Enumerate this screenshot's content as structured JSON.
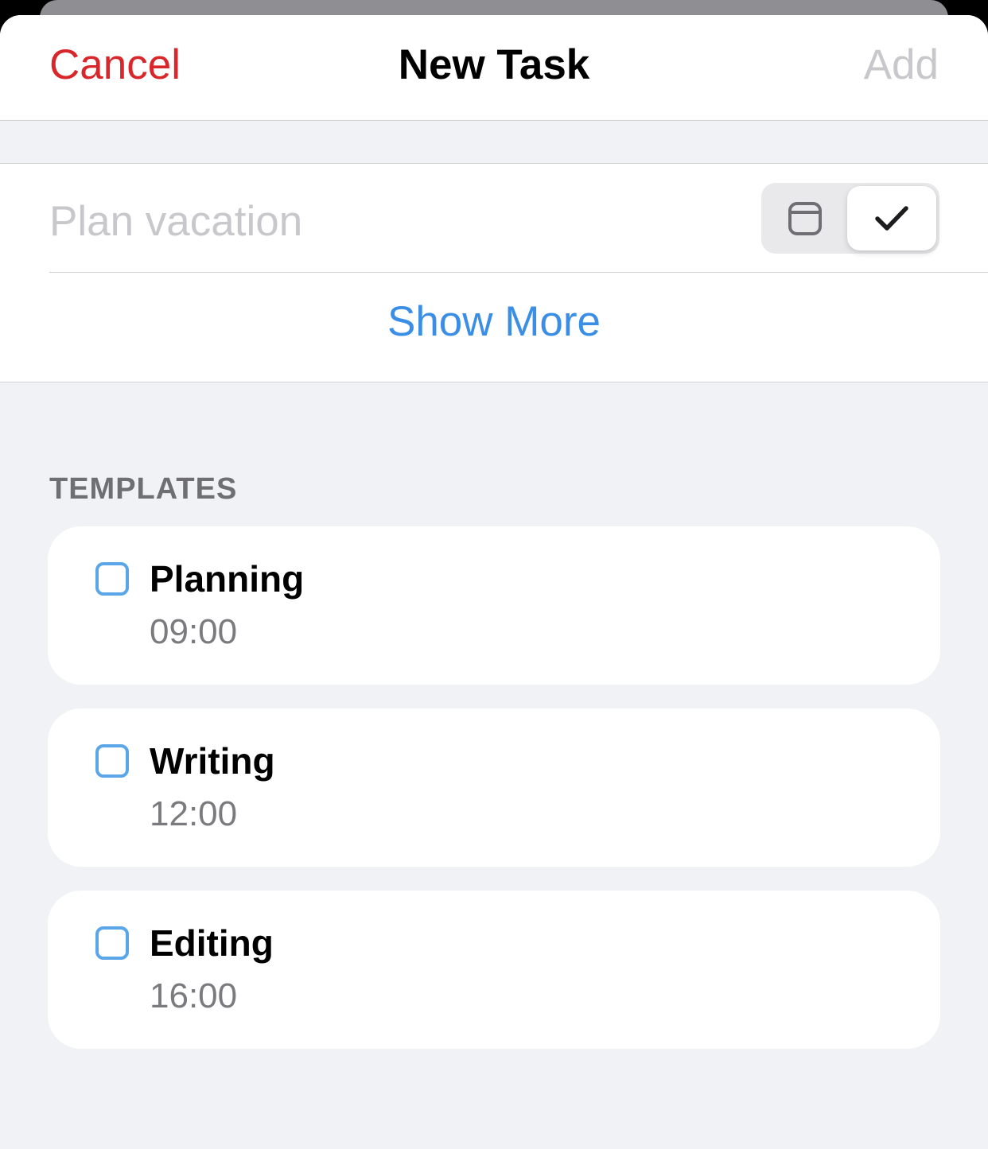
{
  "navbar": {
    "cancel_label": "Cancel",
    "title": "New Task",
    "add_label": "Add"
  },
  "entry": {
    "placeholder": "Plan vacation",
    "value": "",
    "type_toggle": {
      "options": [
        {
          "icon": "calendar-icon",
          "selected": false
        },
        {
          "icon": "checkmark-icon",
          "selected": true
        }
      ]
    },
    "show_more_label": "Show More"
  },
  "templates": {
    "header": "TEMPLATES",
    "items": [
      {
        "name": "Planning",
        "time": "09:00",
        "checked": false
      },
      {
        "name": "Writing",
        "time": "12:00",
        "checked": false
      },
      {
        "name": "Editing",
        "time": "16:00",
        "checked": false
      }
    ]
  },
  "colors": {
    "cancel": "#d9262a",
    "link": "#3a8ee6",
    "disabled": "#c7c7cc",
    "checkbox_border": "#5aa6e8",
    "background": "#f0f2f5"
  }
}
